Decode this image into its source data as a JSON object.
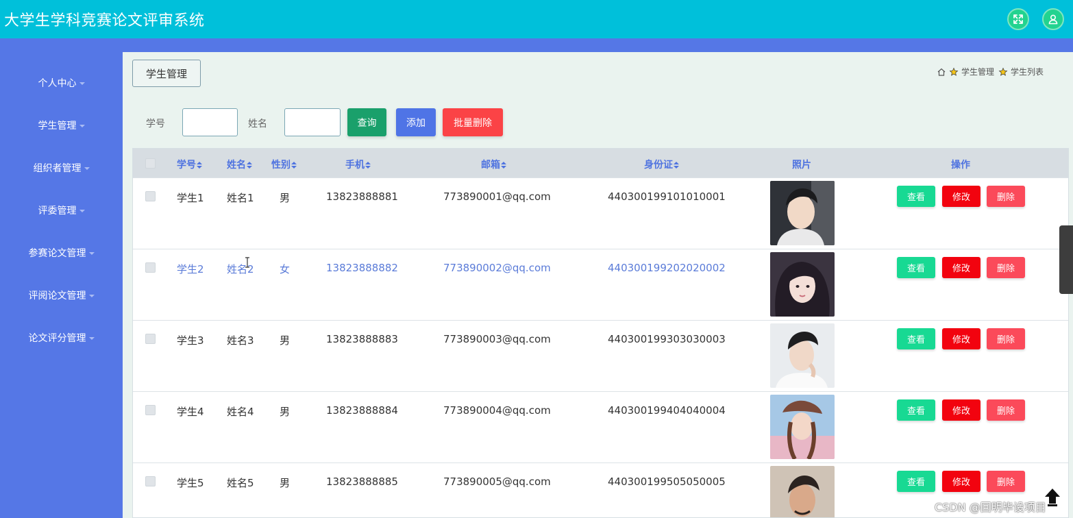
{
  "app": {
    "title": "大学生学科竞赛论文评审系统"
  },
  "header_icons": [
    {
      "name": "fullscreen-icon"
    },
    {
      "name": "user-icon"
    }
  ],
  "sidebar": {
    "items": [
      {
        "label": "个人中心"
      },
      {
        "label": "学生管理"
      },
      {
        "label": "组织者管理"
      },
      {
        "label": "评委管理"
      },
      {
        "label": "参赛论文管理"
      },
      {
        "label": "评阅论文管理"
      },
      {
        "label": "论文评分管理"
      }
    ]
  },
  "page": {
    "tag": "学生管理",
    "breadcrumb": [
      "学生管理",
      "学生列表"
    ]
  },
  "search": {
    "id_label": "学号",
    "id_value": "",
    "name_label": "姓名",
    "name_value": "",
    "query_label": "查询",
    "add_label": "添加",
    "batch_delete_label": "批量删除"
  },
  "table": {
    "headers": {
      "id": "学号",
      "name": "姓名",
      "gender": "性别",
      "phone": "手机",
      "email": "邮箱",
      "idcard": "身份证",
      "photo": "照片",
      "action": "操作"
    },
    "rows": [
      {
        "id": "学生1",
        "name": "姓名1",
        "gender": "男",
        "phone": "13823888881",
        "email": "773890001@qq.com",
        "idcard": "440300199101010001"
      },
      {
        "id": "学生2",
        "name": "姓名2",
        "gender": "女",
        "phone": "13823888882",
        "email": "773890002@qq.com",
        "idcard": "440300199202020002"
      },
      {
        "id": "学生3",
        "name": "姓名3",
        "gender": "男",
        "phone": "13823888883",
        "email": "773890003@qq.com",
        "idcard": "440300199303030003"
      },
      {
        "id": "学生4",
        "name": "姓名4",
        "gender": "男",
        "phone": "13823888884",
        "email": "773890004@qq.com",
        "idcard": "440300199404040004"
      },
      {
        "id": "学生5",
        "name": "姓名5",
        "gender": "男",
        "phone": "13823888885",
        "email": "773890005@qq.com",
        "idcard": "440300199505050005"
      }
    ],
    "actions": {
      "view": "查看",
      "edit": "修改",
      "delete": "删除"
    }
  },
  "watermark": "CSDN @回明毕设项目",
  "colors": {
    "topbar": "#00c0da",
    "sidebar": "#5577e6",
    "accent": "#4f73e0",
    "view_button": "#18d993",
    "edit_button": "#f2030f",
    "delete_button": "#fb4a5a"
  }
}
